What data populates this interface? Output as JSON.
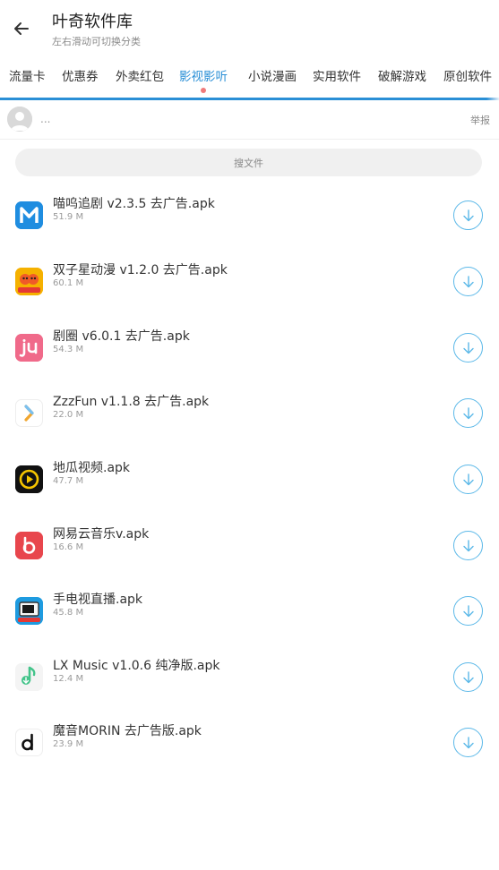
{
  "header": {
    "title": "叶奇软件库",
    "subtitle": "左右滑动可切换分类"
  },
  "tabs": [
    {
      "label": "流量卡",
      "active": false
    },
    {
      "label": "优惠券",
      "active": false
    },
    {
      "label": "外卖红包",
      "active": false
    },
    {
      "label": "影视影听",
      "active": true
    },
    {
      "label": "小说漫画",
      "active": false
    },
    {
      "label": "实用软件",
      "active": false
    },
    {
      "label": "破解游戏",
      "active": false
    },
    {
      "label": "原创软件",
      "active": false
    }
  ],
  "owner": {
    "name": "...",
    "report_label": "举报"
  },
  "search": {
    "placeholder": "搜文件"
  },
  "files": [
    {
      "name": "喵呜追剧 v2.3.5 去广告.apk",
      "size": "51.9 M",
      "icon": "miaowu-app-icon"
    },
    {
      "name": "双子星动漫 v1.2.0 去广告.apk",
      "size": "60.1 M",
      "icon": "shuangzixing-app-icon"
    },
    {
      "name": "剧圈 v6.0.1 去广告.apk",
      "size": "54.3 M",
      "icon": "juquan-app-icon"
    },
    {
      "name": "ZzzFun v1.1.8 去广告.apk",
      "size": "22.0 M",
      "icon": "zzzfun-app-icon"
    },
    {
      "name": "地瓜视频.apk",
      "size": "47.7 M",
      "icon": "digua-app-icon"
    },
    {
      "name": "网易云音乐v.apk",
      "size": "16.6 M",
      "icon": "netease-music-app-icon"
    },
    {
      "name": "手电视直播.apk",
      "size": "45.8 M",
      "icon": "tv-live-app-icon"
    },
    {
      "name": "LX Music v1.0.6 纯净版.apk",
      "size": "12.4 M",
      "icon": "lx-music-app-icon"
    },
    {
      "name": "魔音MORIN 去广告版.apk",
      "size": "23.9 M",
      "icon": "morin-app-icon"
    }
  ],
  "colors": {
    "accent": "#2a8fd6",
    "download_ring": "#5bb8e8",
    "tab_dot": "#f07a7a"
  }
}
